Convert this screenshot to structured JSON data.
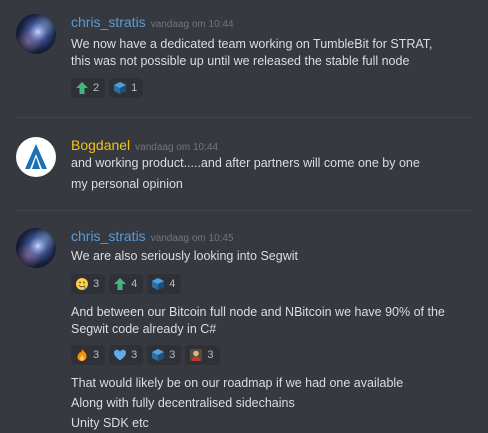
{
  "colors": {
    "background": "#36393f",
    "reaction_bg": "#2f3136",
    "timestamp": "#72767d",
    "user_chris": "#5b9bd5",
    "user_bog": "#f1c40f"
  },
  "messages": [
    {
      "author": "chris_stratis",
      "author_color": "#5b9bd5",
      "timestamp": "vandaag om 10:44",
      "lines": [
        "We now have a dedicated team working on TumbleBit for STRAT,",
        "this was not possible up until we released the stable full node"
      ],
      "reactions": [
        {
          "icon": "green-up-arrow-icon",
          "count": "2"
        },
        {
          "icon": "stratis-cube-icon",
          "count": "1"
        }
      ]
    },
    {
      "author": "Bogdanel",
      "author_color": "#f1c40f",
      "timestamp": "vandaag om 10:44",
      "lines": [
        "and working product.....and after partners will come one by one",
        "my personal opinion"
      ]
    },
    {
      "author": "chris_stratis",
      "author_color": "#5b9bd5",
      "timestamp": "vandaag om 10:45",
      "lines": [
        "We are also seriously looking into Segwit"
      ],
      "reactions": [
        {
          "icon": "drooling-face-icon",
          "count": "3"
        },
        {
          "icon": "green-up-arrow-icon",
          "count": "4"
        },
        {
          "icon": "stratis-cube-icon",
          "count": "4"
        }
      ],
      "lines2": [
        "And between our Bitcoin full node and NBitcoin we have 90% of the",
        "Segwit code already in C#"
      ],
      "reactions2": [
        {
          "icon": "fire-icon",
          "count": "3"
        },
        {
          "icon": "blue-heart-icon",
          "count": "3"
        },
        {
          "icon": "stratis-cube-icon",
          "count": "3"
        },
        {
          "icon": "person-avatar-icon",
          "count": "3"
        }
      ],
      "lines3": [
        "That would likely be on our roadmap if we had one available",
        "Along with fully decentralised sidechains",
        "Unity SDK etc"
      ]
    }
  ]
}
